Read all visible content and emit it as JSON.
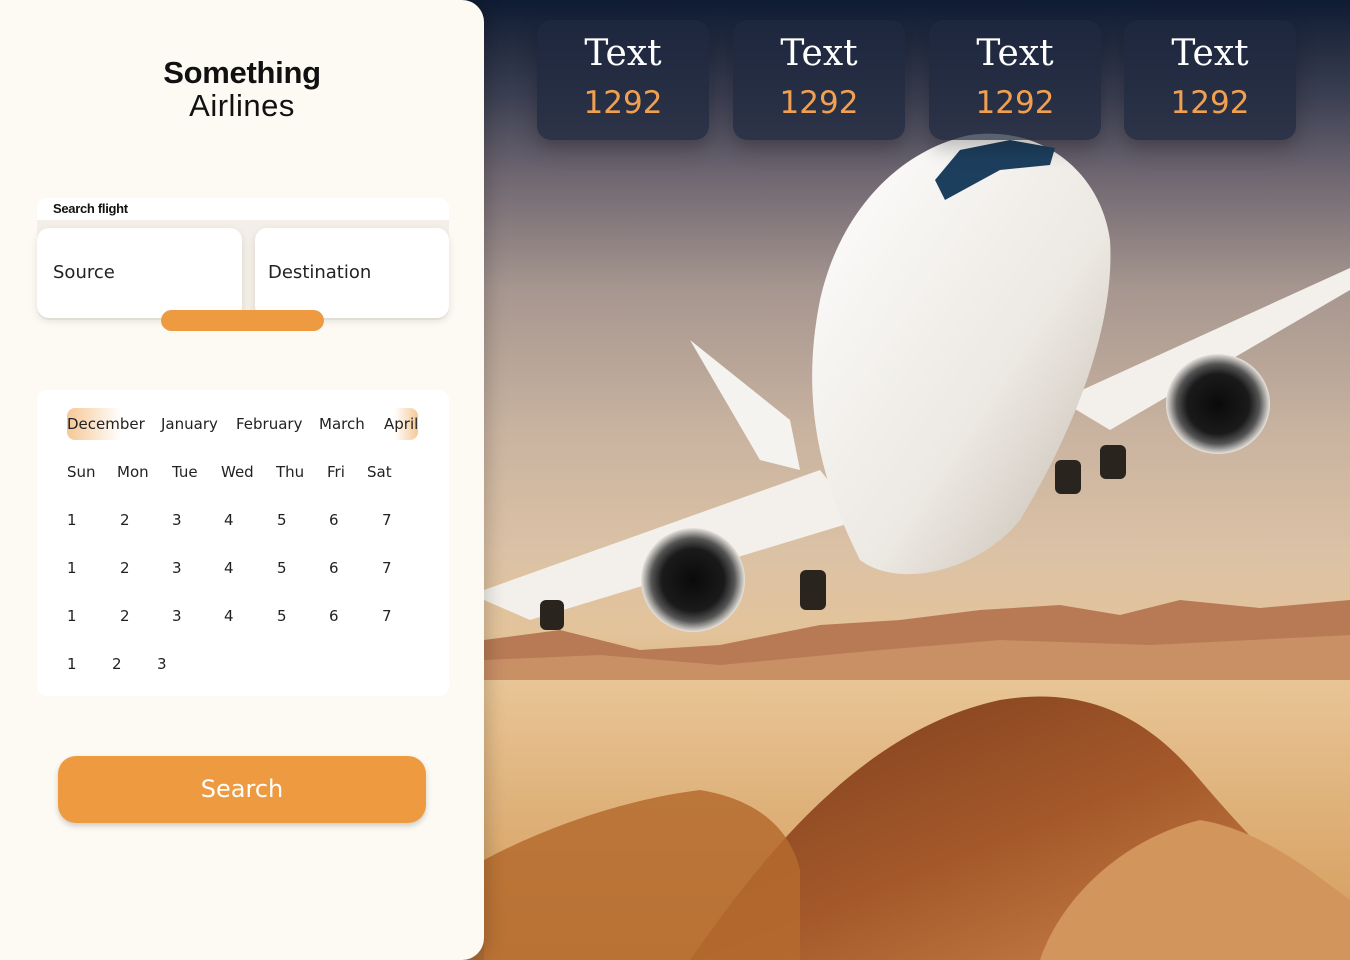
{
  "brand": {
    "line1": "Something",
    "line2": "Airlines"
  },
  "search": {
    "title": "Search flight",
    "source_label": "Source",
    "destination_label": "Destination"
  },
  "calendar": {
    "months": [
      "December",
      "January",
      "February",
      "March",
      "April"
    ],
    "weekdays": [
      "Sun",
      "Mon",
      "Tue",
      "Wed",
      "Thu",
      "Fri",
      "Sat"
    ],
    "weeks": [
      [
        "1",
        "2",
        "3",
        "4",
        "5",
        "6",
        "7"
      ],
      [
        "1",
        "2",
        "3",
        "4",
        "5",
        "6",
        "7"
      ],
      [
        "1",
        "2",
        "3",
        "4",
        "5",
        "6",
        "7"
      ],
      [
        "1",
        "2",
        "3"
      ]
    ]
  },
  "search_button": "Search",
  "stats": [
    {
      "label": "Text",
      "value": "1292"
    },
    {
      "label": "Text",
      "value": "1292"
    },
    {
      "label": "Text",
      "value": "1292"
    },
    {
      "label": "Text",
      "value": "1292"
    }
  ],
  "colors": {
    "accent": "#ee9a40",
    "panel_bg": "#fdf9f3",
    "stat_value": "#f0a050",
    "stat_card_bg": "#1e283e"
  },
  "icons": {
    "hero": "airplane-illustration"
  }
}
